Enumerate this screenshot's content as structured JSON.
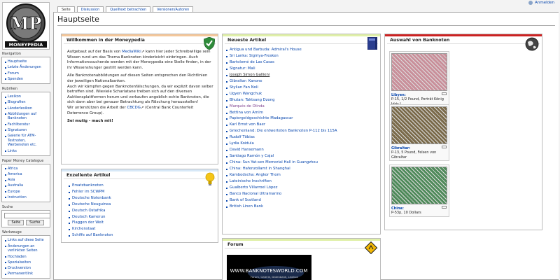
{
  "userbar": {
    "login": "Anmelden"
  },
  "logo": {
    "letters": "MP",
    "wordmark": "MONEYPEDIA"
  },
  "sidebar": {
    "navigation": {
      "title": "Navigation",
      "items": [
        "Hauptseite",
        "Letzte Änderungen",
        "Forum",
        "Spenden"
      ]
    },
    "rubriken": {
      "title": "Rubriken",
      "items": [
        "Lexikon",
        "Biografien",
        "Länderlexikon",
        "Abbildungen auf Banknoten",
        "Fachliteratur",
        "Signaturen",
        "Galerie für ATM-Testnoten, Werbenoten etc.",
        "Links"
      ]
    },
    "catalogue": {
      "title": "Paper Money Catalogue",
      "items": [
        "Africa",
        "America",
        "Asia",
        "Australia",
        "Europe",
        "Instruction"
      ]
    },
    "search": {
      "title": "Suche",
      "placeholder": "",
      "go_label": "Seite",
      "search_label": "Suche"
    },
    "tools": {
      "title": "Werkzeuge",
      "items": [
        "Links auf diese Seite",
        "Änderungen an verlinkten Seiten",
        "Hochladen",
        "Spezialseiten",
        "Druckversion",
        "Permanentlink"
      ]
    }
  },
  "tabs": [
    {
      "label": "Seite",
      "active": true
    },
    {
      "label": "Diskussion",
      "active": false
    },
    {
      "label": "Quelltext betrachten",
      "active": false
    },
    {
      "label": "Versionen/Autoren",
      "active": false
    }
  ],
  "page": {
    "title": "Hauptseite"
  },
  "welcome": {
    "heading": "Willkommen in der Moneypedia",
    "p1_a": "Aufgebaut auf der Basis von ",
    "p1_link": "MediaWiki",
    "p1_b": " kann hier jeder Schreibwillige sein Wissen rund um das Thema Banknoten kinderleicht einbringen. Auch Informationssuchende werden mit der Moneypedia eine Stelle finden, in der ihr Wissenshunger gestillt werden kann.",
    "p2": "Alle Banknotenabbildungen auf diesen Seiten entsprechen den Richtlinien der jeweiligen Nationalbanken.",
    "p3": "Auch wir kämpfen gegen Banknotenfälschungen, da wir explizit davon selber betroffen sind. Wieviele Scharlatane treiben sich auf den diversen Auktionsplattformen herum und verkaufen angeblich echte Banknoten, die sich dann aber bei genauer Betrachtung als Fälschung herausstellen!",
    "p4_a": "Wir unterstützen die Arbeit der ",
    "p4_link": "CBCDG",
    "p4_b": " (Central Bank Counterfeit Deterrence Group).",
    "p5": "Sei mutig - mach mit!"
  },
  "excellent": {
    "heading": "Exzellente Artikel",
    "items": [
      "Ersatzbanknoten",
      "Fehler im SCWPM",
      "Deutsche Notenbank",
      "Deutsche Neuguinea",
      "Deutsch Ostafrika",
      "Deutsch Kamerun",
      "Flaggen der Welt",
      "Kirchenstaat",
      "Schiffe auf Banknoten"
    ]
  },
  "newest": {
    "heading": "Neueste Artikel",
    "items": [
      {
        "text": "Antigua und Barbuda: Admiral's House",
        "style": ""
      },
      {
        "text": "Sri Lanka: Sigiriya-Fresken",
        "style": ""
      },
      {
        "text": "Bartolomé de Las Casas",
        "style": ""
      },
      {
        "text": "Signatur: Mali",
        "style": ""
      },
      {
        "text": "Joseph Simon Gallieni",
        "style": "underlined"
      },
      {
        "text": "Gibraltar: Kanone",
        "style": ""
      },
      {
        "text": "Stylian Fan Noli",
        "style": ""
      },
      {
        "text": "Ugyen Wangchuk",
        "style": ""
      },
      {
        "text": "Bhutan: Taktsang Dzong",
        "style": ""
      },
      {
        "text": "Marqués de Olinda",
        "style": "visited"
      },
      {
        "text": "Bettina von Arnim",
        "style": ""
      },
      {
        "text": "Papiergeldgeschichte Madagascar",
        "style": ""
      },
      {
        "text": "Karl Ernst von Baer",
        "style": ""
      },
      {
        "text": "Griechenland: Die entwerteten Banknoten P-112 bis 115A",
        "style": ""
      },
      {
        "text": "Rudolf Tōbias",
        "style": ""
      },
      {
        "text": "Lydia Koidula",
        "style": ""
      },
      {
        "text": "David Hansemann",
        "style": ""
      },
      {
        "text": "Santiago Ramón y Cajal",
        "style": ""
      },
      {
        "text": "China: Sun Yat-sen Memorial Hall in Guangzhou",
        "style": ""
      },
      {
        "text": "China: Hafenzollamt in Shanghai",
        "style": ""
      },
      {
        "text": "Kambodscha: Angkor Thom",
        "style": ""
      },
      {
        "text": "Lateinische Inschriften",
        "style": ""
      },
      {
        "text": "Gualberto Villarroel López",
        "style": ""
      },
      {
        "text": "Banco Nacional Ultramarino",
        "style": ""
      },
      {
        "text": "Bank of Scotland",
        "style": ""
      },
      {
        "text": "British Linen Bank",
        "style": ""
      }
    ]
  },
  "forum": {
    "heading": "Forum",
    "banner_title": "WWW.BANKNOTESWORLD.COM",
    "banner_sub": "Forum, Galerie, Datenbank, Lexikon"
  },
  "selection": {
    "heading": "Auswahl von Banknoten",
    "notes": [
      {
        "country": "Libyen:",
        "caption": "P-15, 1/2 Pound, Porträt König Idris I",
        "color": "#c98f9a"
      },
      {
        "country": "Gibraltar:",
        "caption": "P-13, 5 Pound, Felsen von Gibraltar",
        "color": "#7a6a4a"
      },
      {
        "country": "China:",
        "caption": "P-53p, 10 Dollars",
        "color": "#4f8a5a"
      }
    ]
  }
}
